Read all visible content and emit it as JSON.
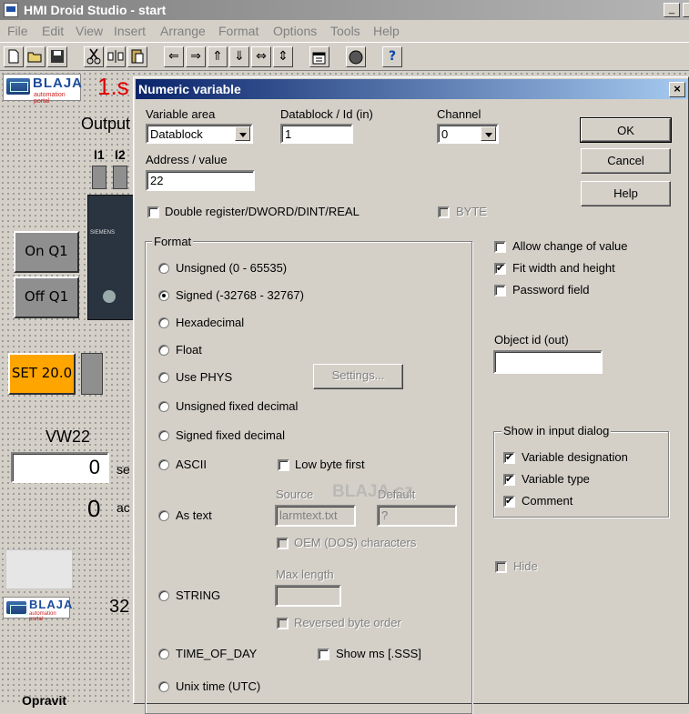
{
  "window": {
    "title": "HMI Droid Studio - start",
    "min_label": "_",
    "close_label": "×"
  },
  "menu": [
    "File",
    "Edit",
    "View",
    "Insert",
    "Arrange",
    "Format",
    "Options",
    "Tools",
    "Help"
  ],
  "toolbar": {
    "new": "new-icon",
    "open": "open-icon",
    "save": "save-icon",
    "cut": "cut-icon",
    "align_h": "align-horizontal-icon",
    "paste": "paste-icon",
    "arrow_left": "⇐",
    "arrow_right": "⇒",
    "arrow_up": "⇑",
    "arrow_down": "⇓",
    "arrow_lr": "⇔",
    "arrow_ud": "⇕",
    "help": "?"
  },
  "canvas": {
    "logo_name": "BLAJA",
    "logo_sub": "automation portal",
    "page_title": "1.s",
    "output_label": "Output",
    "i1": "I1",
    "i2": "I2",
    "plc_brand": "SIEMENS",
    "on_btn": "On Q1",
    "off_btn": "Off Q1",
    "set_btn": "SET 20.0",
    "vw_label": "VW22",
    "value_field": "0",
    "value_suffix": "se",
    "actual_value": "0",
    "actual_suffix": "ac",
    "bottom_number": "32",
    "bottom_text": "Opravit"
  },
  "dialog": {
    "title": "Numeric variable",
    "close": "×",
    "variable_area_label": "Variable area",
    "variable_area_value": "Datablock",
    "datablock_label": "Datablock / Id (in)",
    "datablock_value": "1",
    "channel_label": "Channel",
    "channel_value": "0",
    "address_label": "Address / value",
    "address_value": "22",
    "double_register": "Double register/DWORD/DINT/REAL",
    "byte": "BYTE",
    "ok": "OK",
    "cancel": "Cancel",
    "help": "Help",
    "format_label": "Format",
    "formats": [
      "Unsigned (0 - 65535)",
      "Signed (-32768 - 32767)",
      "Hexadecimal",
      "Float",
      "Use PHYS",
      "Unsigned fixed decimal",
      "Signed fixed decimal",
      "ASCII",
      "As text",
      "STRING",
      "TIME_OF_DAY",
      "Unix time (UTC)"
    ],
    "selected_format": "Signed (-32768 - 32767)",
    "settings_btn": "Settings...",
    "low_byte_first": "Low byte first",
    "source_label": "Source",
    "source_value": "larmtext.txt",
    "default_label": "Default",
    "default_value": "?",
    "oem_chars": "OEM (DOS) characters",
    "max_length_label": "Max length",
    "max_length_value": "",
    "reversed_byte_order": "Reversed byte order",
    "show_ms": "Show ms [.SSS]",
    "allow_change": "Allow change of value",
    "fit_width": "Fit width and height",
    "password_field": "Password field",
    "object_id_label": "Object id (out)",
    "object_id_value": "",
    "show_dialog_label": "Show in input dialog",
    "var_designation": "Variable designation",
    "var_type": "Variable type",
    "comment": "Comment",
    "hide": "Hide",
    "watermark": "BLAJA.cz"
  }
}
